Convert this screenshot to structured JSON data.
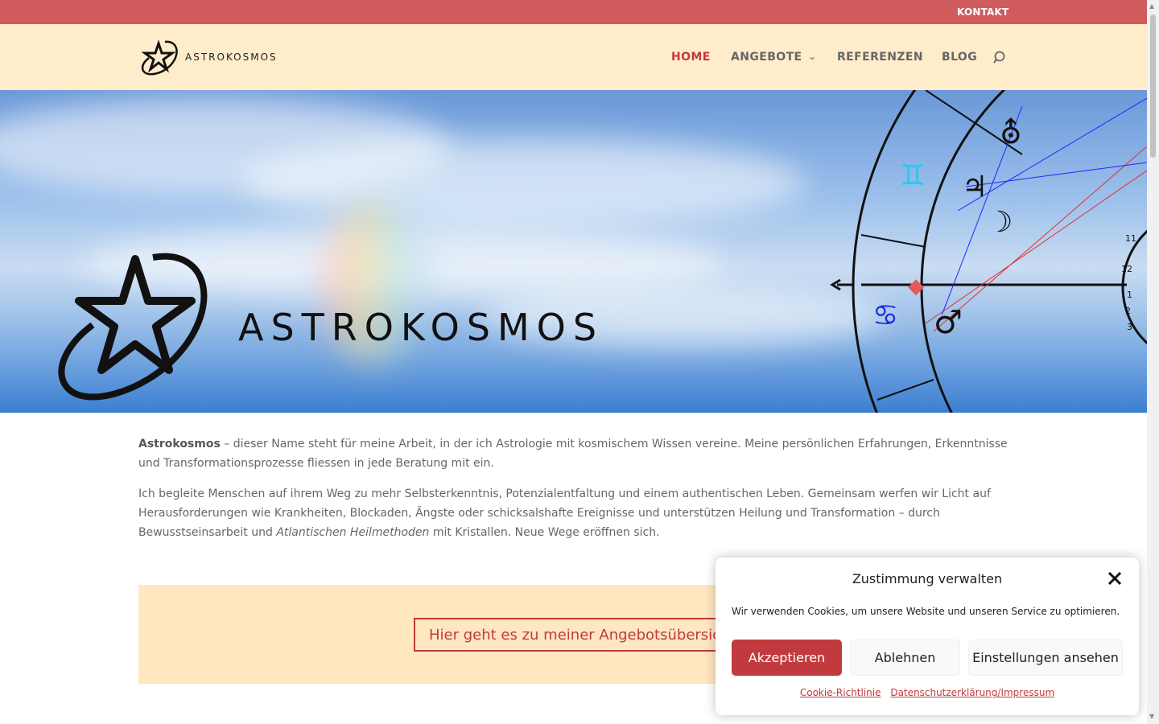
{
  "topbar": {
    "contact_label": "KONTAKT"
  },
  "header": {
    "logo_text": "ASTROKOSMOS",
    "nav": {
      "home": "HOME",
      "angebote": "ANGEBOTE",
      "referenzen": "REFERENZEN",
      "blog": "BLOG"
    }
  },
  "hero": {
    "brand_text": "ASTROKOSMOS",
    "chart_numbers": [
      "11",
      "12",
      "1",
      "2",
      "3"
    ]
  },
  "content": {
    "p1_strong": "Astrokosmos",
    "p1_rest": " – dieser Name steht für meine Arbeit, in der ich Astrologie mit kosmischem Wissen vereine. Meine persönlichen Erfahrungen, Erkenntnisse und Transformationsprozesse fliessen in jede Beratung mit ein.",
    "p2_a": "Ich begleite Menschen auf ihrem Weg zu mehr Selbsterkenntnis, Potenzialentfaltung und einem authentischen Leben. Gemeinsam werfen wir Licht auf Herausforderungen wie Krankheiten, Blockaden, Ängste oder schicksalshafte Ereignisse und unterstützen Heilung und Transformation – durch Bewusstseinsarbeit und ",
    "p2_em": "Atlantischen Heilmethoden",
    "p2_b": " mit Kristallen. Neue Wege eröffnen sich.",
    "cta_label": "Hier geht es zu meiner Angebotsübersicht"
  },
  "cookie": {
    "title": "Zustimmung verwalten",
    "text": "Wir verwenden Cookies, um unsere Website und unseren Service zu optimieren.",
    "accept": "Akzeptieren",
    "decline": "Ablehnen",
    "settings": "Einstellungen ansehen",
    "link_cookie": "Cookie-Richtlinie",
    "link_privacy": "Datenschutzerklärung/Impressum"
  },
  "colors": {
    "accent": "#c13a3d",
    "topbar": "#d05b5c",
    "header_bg": "#ffeccb",
    "cta_bg": "#ffe7c0"
  }
}
